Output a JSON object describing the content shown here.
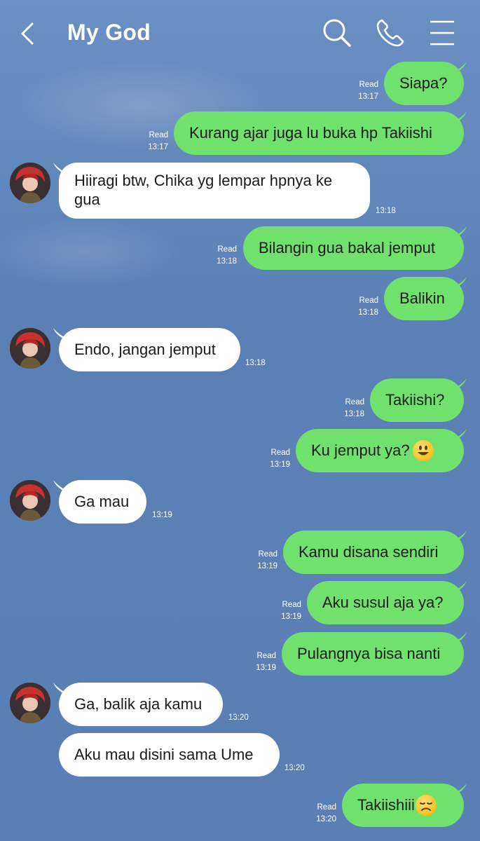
{
  "header": {
    "back_icon": "chevron-left-icon",
    "title": "My God",
    "search_icon": "search-icon",
    "call_icon": "phone-icon",
    "menu_icon": "hamburger-menu-icon"
  },
  "colors": {
    "background": "#5d82b9",
    "outgoing_bubble": "#71e16d",
    "incoming_bubble": "#ffffff",
    "header_text": "#ffffff"
  },
  "messages": [
    {
      "direction": "out",
      "text": "Siapa?",
      "status": "Read",
      "time": "13:17"
    },
    {
      "direction": "out",
      "text": "Kurang ajar juga lu buka hp Takiishi",
      "status": "Read",
      "time": "13:17"
    },
    {
      "direction": "in",
      "text": "Hiiragi btw, Chika yg lempar hpnya ke gua",
      "time": "13:18"
    },
    {
      "direction": "out",
      "text": "Bilangin gua bakal jemput",
      "status": "Read",
      "time": "13:18"
    },
    {
      "direction": "out",
      "text": "Balikin",
      "status": "Read",
      "time": "13:18"
    },
    {
      "direction": "in",
      "text": "Endo, jangan jemput",
      "time": "13:18"
    },
    {
      "direction": "out",
      "text": "Takiishi?",
      "status": "Read",
      "time": "13:18"
    },
    {
      "direction": "out",
      "text": "Ku jemput ya?",
      "emoji": "smiley-face-icon",
      "status": "Read",
      "time": "13:19"
    },
    {
      "direction": "in",
      "text": "Ga mau",
      "time": "13:19"
    },
    {
      "direction": "out",
      "text": "Kamu disana sendiri",
      "status": "Read",
      "time": "13:19"
    },
    {
      "direction": "out",
      "text": "Aku susul aja ya?",
      "status": "Read",
      "time": "13:19"
    },
    {
      "direction": "out",
      "text": "Pulangnya bisa nanti",
      "status": "Read",
      "time": "13:19"
    },
    {
      "direction": "in",
      "text": "Ga, balik aja kamu",
      "time": "13:20"
    },
    {
      "direction": "in",
      "text": "Aku mau disini sama Ume",
      "time": "13:20"
    },
    {
      "direction": "out",
      "text": "Takiishiii",
      "emoji": "disappointed-face-icon",
      "status": "Read",
      "time": "13:20"
    }
  ]
}
